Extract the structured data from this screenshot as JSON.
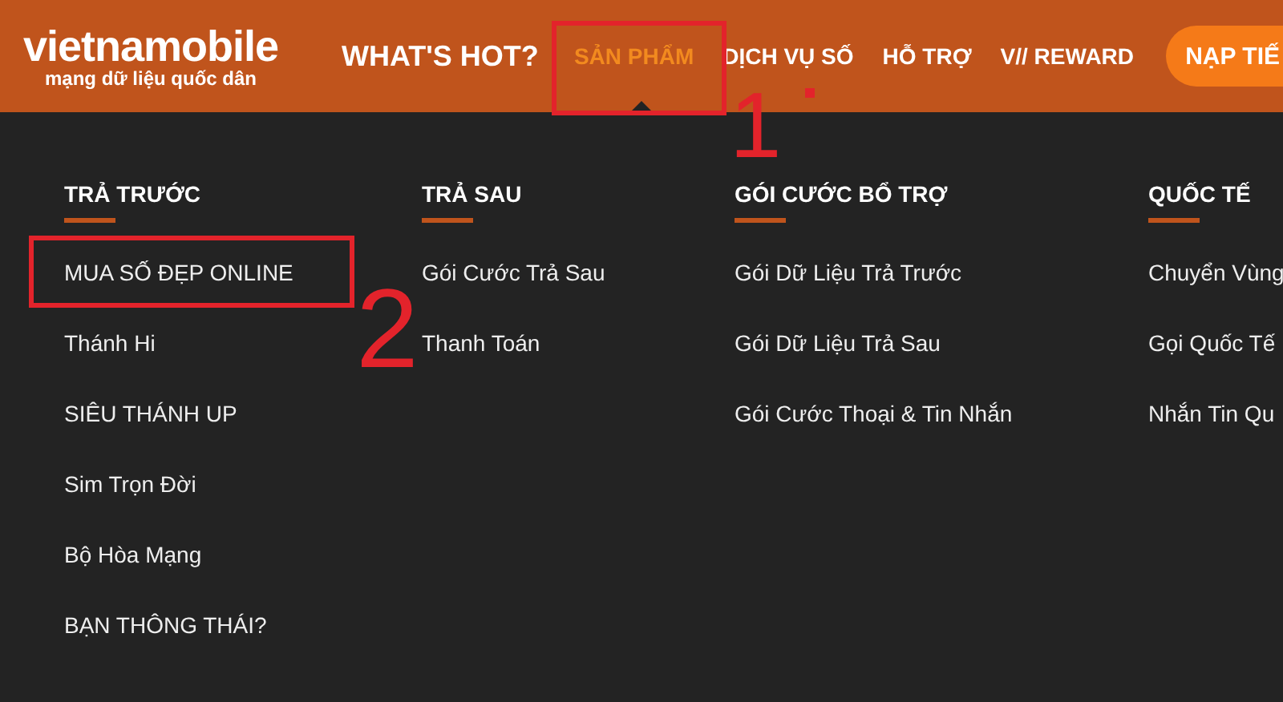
{
  "logo": {
    "name": "vietnamobile",
    "tagline": "mạng dữ liệu quốc dân"
  },
  "nav": [
    {
      "label": "WHAT'S HOT?",
      "kind": "hot",
      "selected": false
    },
    {
      "label": "SẢN PHẨM",
      "kind": "link",
      "selected": true
    },
    {
      "label": "DỊCH VỤ SỐ",
      "kind": "link",
      "selected": false
    },
    {
      "label": "HỖ TRỢ",
      "kind": "link",
      "selected": false
    },
    {
      "label": "V// REWARD",
      "kind": "link",
      "selected": false
    }
  ],
  "topup_button": "NẠP TIẾ",
  "menu_columns": [
    {
      "heading": "TRẢ TRƯỚC",
      "items": [
        "MUA SỐ ĐẸP ONLINE",
        "Thánh Hi",
        "SIÊU THÁNH UP",
        "Sim Trọn Đời",
        "Bộ Hòa Mạng",
        "BẠN THÔNG THÁI?"
      ]
    },
    {
      "heading": "TRẢ SAU",
      "items": [
        "Gói Cước Trả Sau",
        "Thanh Toán"
      ]
    },
    {
      "heading": "GÓI CƯỚC BỔ TRỢ",
      "items": [
        "Gói Dữ Liệu Trả Trước",
        "Gói Dữ Liệu Trả Sau",
        "Gói Cước Thoại & Tin Nhắn"
      ]
    },
    {
      "heading": "QUỐC TẾ",
      "items": [
        "Chuyển Vùng",
        "Gọi Quốc Tế",
        "Nhắn Tin Qu"
      ]
    }
  ],
  "annotations": [
    {
      "label": "1"
    },
    {
      "label": "2"
    }
  ]
}
